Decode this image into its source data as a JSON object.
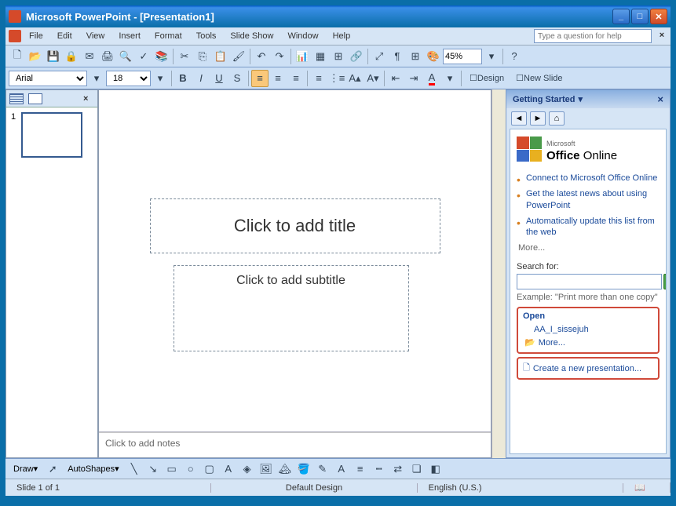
{
  "window": {
    "title": "Microsoft PowerPoint - [Presentation1]"
  },
  "menu": {
    "file": "File",
    "edit": "Edit",
    "view": "View",
    "insert": "Insert",
    "format": "Format",
    "tools": "Tools",
    "slideshow": "Slide Show",
    "window": "Window",
    "help": "Help",
    "help_search_placeholder": "Type a question for help"
  },
  "toolbar": {
    "zoom": "45%",
    "font": "Arial",
    "font_size": "18",
    "design": "Design",
    "new_slide": "New Slide"
  },
  "slide": {
    "title_placeholder": "Click to add title",
    "subtitle_placeholder": "Click to add subtitle",
    "notes_placeholder": "Click to add notes",
    "thumb_number": "1"
  },
  "taskpane": {
    "title": "Getting Started",
    "office_brand": "Office",
    "office_suffix": "Online",
    "bullets": [
      "Connect to Microsoft Office Online",
      "Get the latest news about using PowerPoint",
      "Automatically update this list from the web"
    ],
    "more": "More...",
    "search_label": "Search for:",
    "example_label": "Example:",
    "example_text": "\"Print more than one copy\"",
    "open_title": "Open",
    "open_file": "AA_I_sissejuh",
    "open_more": "More...",
    "create": "Create a new presentation..."
  },
  "drawbar": {
    "draw": "Draw",
    "autoshapes": "AutoShapes"
  },
  "status": {
    "slide": "Slide 1 of 1",
    "design": "Default Design",
    "lang": "English (U.S.)"
  },
  "microsoft_label": "Microsoft"
}
